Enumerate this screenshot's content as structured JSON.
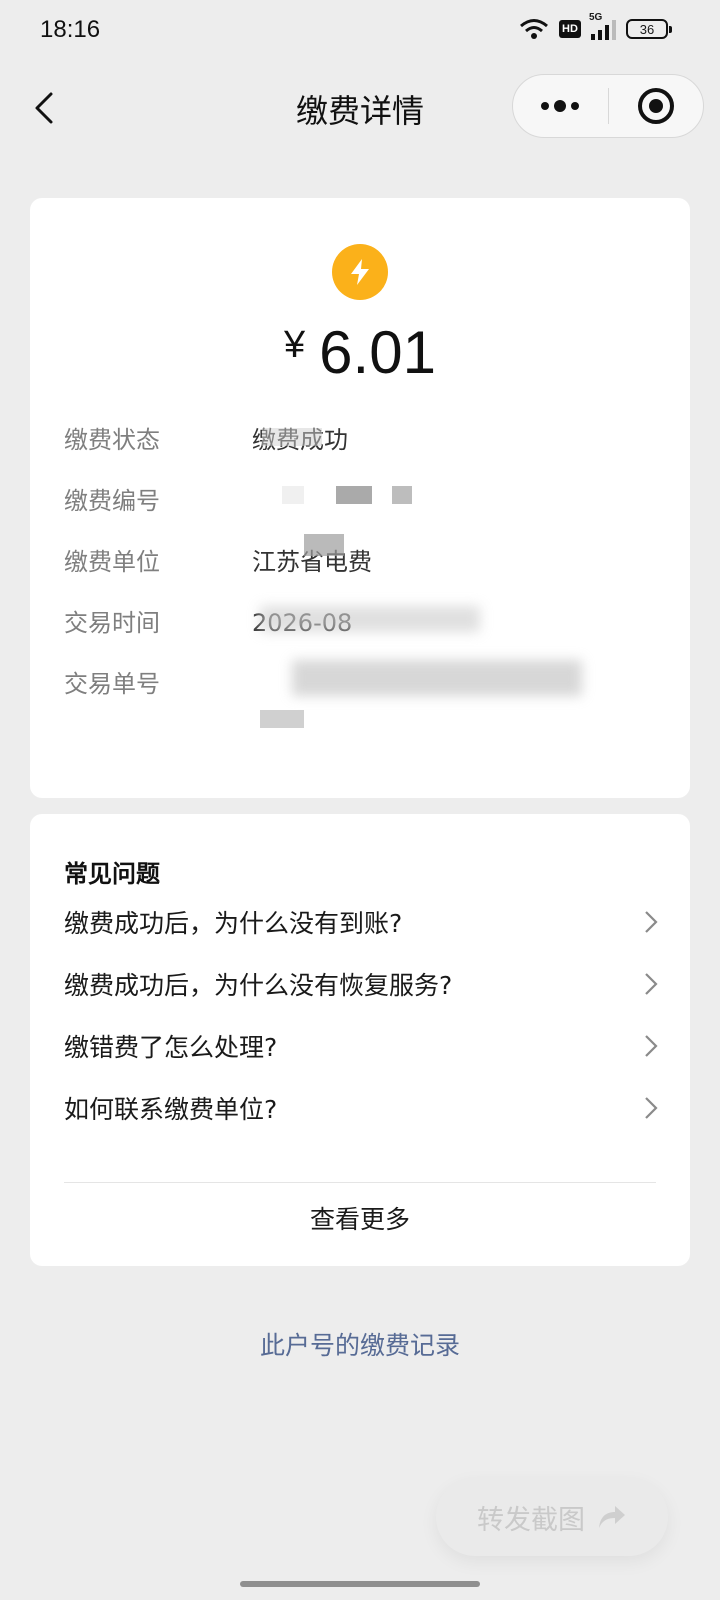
{
  "status_bar": {
    "time": "18:16",
    "network": "5G",
    "hd_label": "HD",
    "battery": "36"
  },
  "nav": {
    "title": "缴费详情",
    "back_icon": "chevron-left-icon",
    "more_icon": "more-dots-icon",
    "close_icon": "target-close-icon"
  },
  "payment": {
    "icon": "lightning-bolt-icon",
    "icon_color": "#fbb11a",
    "currency": "¥",
    "amount": "6.01",
    "rows": [
      {
        "label": "缴费状态",
        "value": "缴费成功"
      },
      {
        "label": "缴费编号",
        "value": ""
      },
      {
        "label": "缴费单位",
        "value": "江苏省电费"
      },
      {
        "label": "交易时间",
        "value": "2026-08"
      },
      {
        "label": "交易单号",
        "value": ""
      }
    ]
  },
  "faq": {
    "title": "常见问题",
    "items": [
      "缴费成功后，为什么没有到账?",
      "缴费成功后，为什么没有恢复服务?",
      "缴错费了怎么处理?",
      "如何联系缴费单位?"
    ],
    "see_more": "查看更多"
  },
  "records_link": "此户号的缴费记录",
  "share_button": "转发截图",
  "colors": {
    "background": "#ededed",
    "link": "#576b95",
    "accent": "#fbb11a"
  }
}
